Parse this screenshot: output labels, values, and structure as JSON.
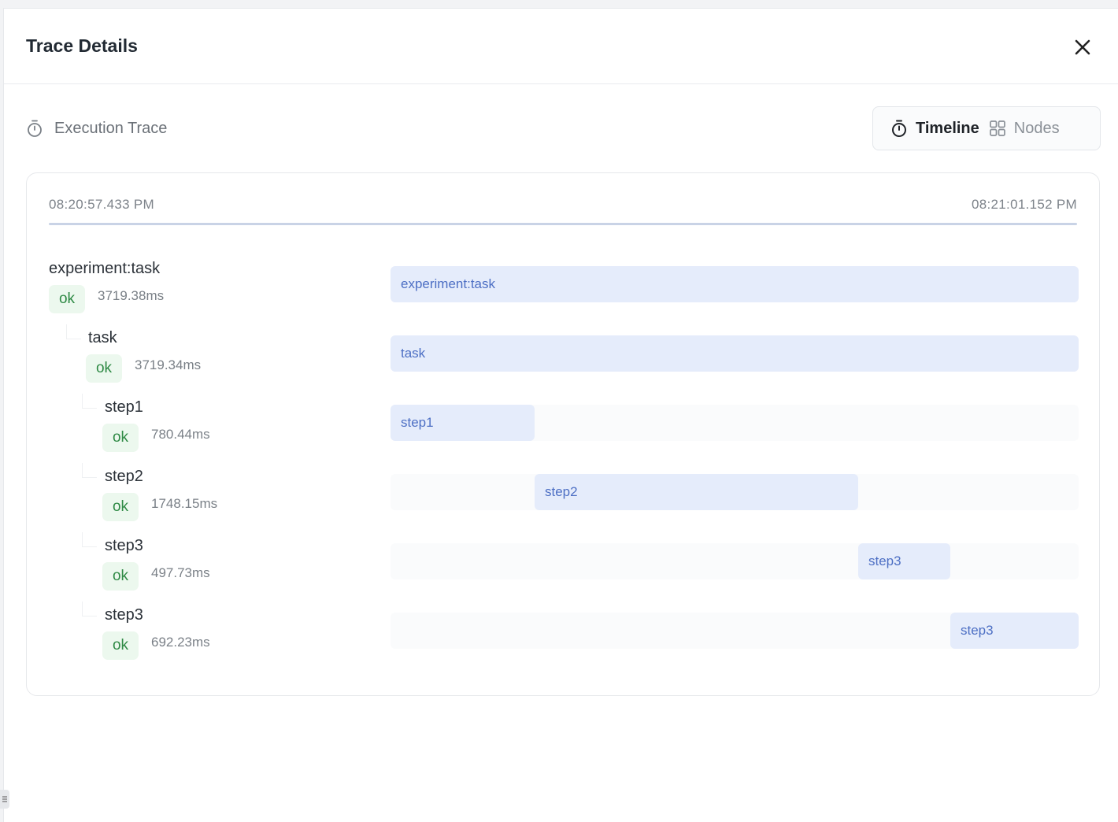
{
  "dialog": {
    "title": "Trace Details",
    "close_icon": "close-icon"
  },
  "section": {
    "title": "Execution Trace",
    "icon": "stopwatch-icon"
  },
  "view_toggle": {
    "timeline_label": "Timeline",
    "nodes_label": "Nodes",
    "selected": "Timeline"
  },
  "timeline": {
    "start_time": "08:20:57.433 PM",
    "end_time": "08:21:01.152 PM",
    "spans": [
      {
        "name": "experiment:task",
        "status": "ok",
        "duration": "3719.38ms",
        "depth": 0
      },
      {
        "name": "task",
        "status": "ok",
        "duration": "3719.34ms",
        "depth": 1
      },
      {
        "name": "step1",
        "status": "ok",
        "duration": "780.44ms",
        "depth": 2
      },
      {
        "name": "step2",
        "status": "ok",
        "duration": "1748.15ms",
        "depth": 2
      },
      {
        "name": "step3",
        "status": "ok",
        "duration": "497.73ms",
        "depth": 2
      },
      {
        "name": "step3",
        "status": "ok",
        "duration": "692.23ms",
        "depth": 2
      }
    ]
  },
  "colors": {
    "status_ok_bg": "#ecf8ee",
    "status_ok_text": "#2f8a45",
    "bar_fill": "#e5ecfb",
    "bar_text": "#4d6fc4"
  }
}
